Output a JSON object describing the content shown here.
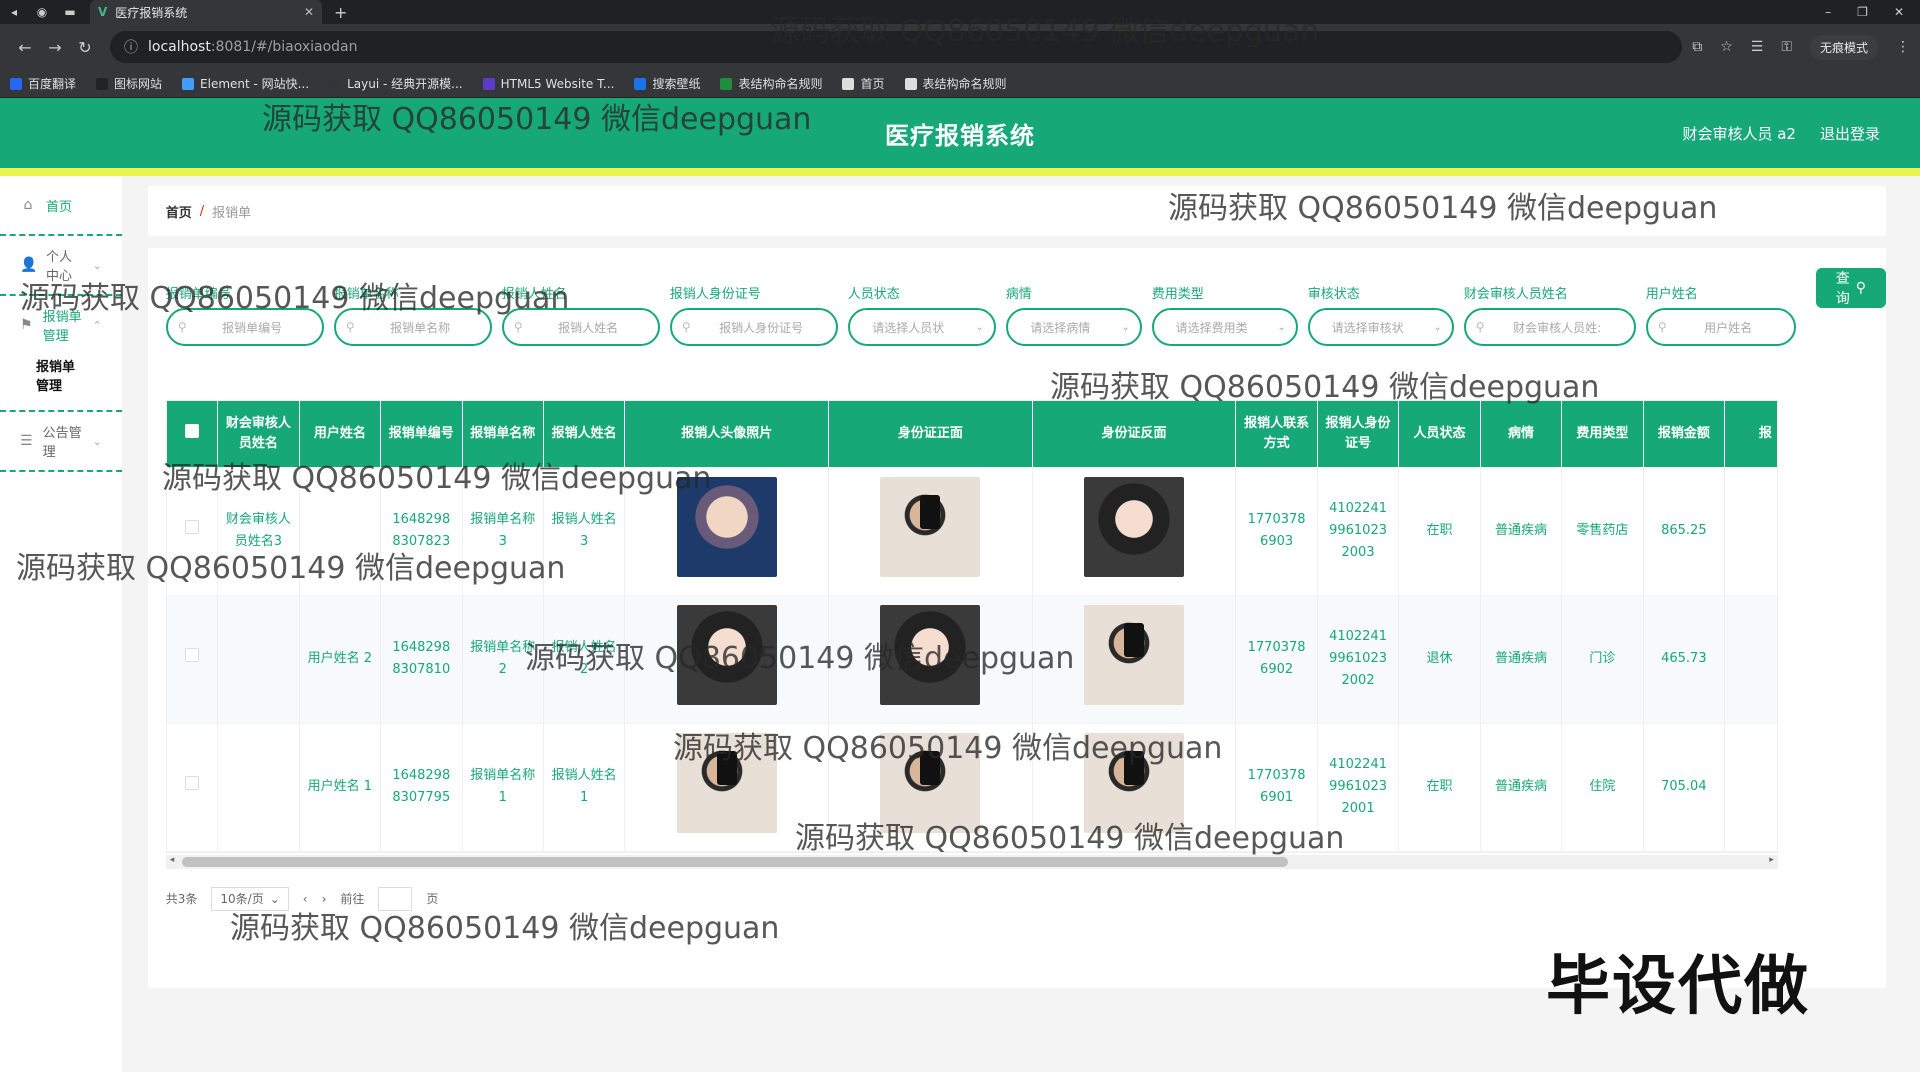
{
  "browser": {
    "tab_title": "医疗报销系统",
    "url_host": "localhost",
    "url_path": ":8081/#/biaoxiaodan",
    "incognito_label": "无痕模式",
    "bookmarks": [
      {
        "label": "百度翻译",
        "color": "#2468f2"
      },
      {
        "label": "图标网站",
        "color": "#222222"
      },
      {
        "label": "Element - 网站快...",
        "color": "#409eff"
      },
      {
        "label": "Layui - 经典开源模...",
        "color": "#2f363c"
      },
      {
        "label": "HTML5 Website T...",
        "color": "#5b3cc4"
      },
      {
        "label": "搜索壁纸",
        "color": "#1a73e8"
      },
      {
        "label": "表结构命名规则",
        "color": "#1e8e3e"
      },
      {
        "label": "首页",
        "color": "#dddddd"
      },
      {
        "label": "表结构命名规则",
        "color": "#dddddd"
      }
    ]
  },
  "header": {
    "title": "医疗报销系统",
    "user": "财会审核人员 a2",
    "logout": "退出登录"
  },
  "sidebar": {
    "home": "首页",
    "personal": "个人中心",
    "claims": "报销单管理",
    "claims_sub": "报销单管理",
    "notice": "公告管理"
  },
  "breadcrumb": {
    "home": "首页",
    "sep": "/",
    "current": "报销单"
  },
  "search": {
    "fields": [
      {
        "label": "报销单编号",
        "placeholder": "报销单编号",
        "type": "input",
        "width": 118
      },
      {
        "label": "报销单名称",
        "placeholder": "报销单名称",
        "type": "input",
        "width": 118
      },
      {
        "label": "报销人姓名",
        "placeholder": "报销人姓名",
        "type": "input",
        "width": 118
      },
      {
        "label": "报销人身份证号",
        "placeholder": "报销人身份证号",
        "type": "input",
        "width": 128
      },
      {
        "label": "人员状态",
        "placeholder": "请选择人员状",
        "type": "select",
        "width": 108
      },
      {
        "label": "病情",
        "placeholder": "请选择病情",
        "type": "select",
        "width": 96
      },
      {
        "label": "费用类型",
        "placeholder": "请选择费用类",
        "type": "select",
        "width": 106
      },
      {
        "label": "审核状态",
        "placeholder": "请选择审核状",
        "type": "select",
        "width": 106
      },
      {
        "label": "财会审核人员姓名",
        "placeholder": "财会审核人员姓:",
        "type": "input",
        "width": 132
      },
      {
        "label": "用户姓名",
        "placeholder": "用户姓名",
        "type": "input",
        "width": 110
      }
    ],
    "query_button": "查询"
  },
  "table": {
    "columns": [
      {
        "label": "",
        "w": 50
      },
      {
        "label": "财会审核人员姓名",
        "w": 80
      },
      {
        "label": "用户姓名",
        "w": 80
      },
      {
        "label": "报销单编号",
        "w": 80
      },
      {
        "label": "报销单名称",
        "w": 80
      },
      {
        "label": "报销人姓名",
        "w": 80
      },
      {
        "label": "报销人头像照片",
        "w": 200
      },
      {
        "label": "身份证正面",
        "w": 200
      },
      {
        "label": "身份证反面",
        "w": 200
      },
      {
        "label": "报销人联系方式",
        "w": 80
      },
      {
        "label": "报销人身份证号",
        "w": 80
      },
      {
        "label": "人员状态",
        "w": 80
      },
      {
        "label": "病情",
        "w": 80
      },
      {
        "label": "费用类型",
        "w": 80
      },
      {
        "label": "报销金额",
        "w": 80
      },
      {
        "label": "报",
        "w": 80
      }
    ],
    "rows": [
      {
        "auditor": "财会审核人员姓名3",
        "user": "",
        "code": "1648298 8307823",
        "name": "报销单名称3",
        "claimant": "报销人姓名3",
        "avatar": "boy",
        "idf": "man",
        "idb": "girl",
        "phone": "1770378 6903",
        "idno": "4102241 9961023 2003",
        "status": "在职",
        "illness": "普通疾病",
        "fee": "零售药店",
        "amount": "865.25"
      },
      {
        "auditor": "",
        "user": "用户姓名 2",
        "code": "1648298 8307810",
        "name": "报销单名称2",
        "claimant": "报销人姓名2",
        "avatar": "girl",
        "idf": "girl",
        "idb": "man",
        "phone": "1770378 6902",
        "idno": "4102241 9961023 2002",
        "status": "退休",
        "illness": "普通疾病",
        "fee": "门诊",
        "amount": "465.73"
      },
      {
        "auditor": "",
        "user": "用户姓名 1",
        "code": "1648298 8307795",
        "name": "报销单名称1",
        "claimant": "报销人姓名1",
        "avatar": "man",
        "idf": "man",
        "idb": "man",
        "phone": "1770378 6901",
        "idno": "4102241 9961023 2001",
        "status": "在职",
        "illness": "普通疾病",
        "fee": "住院",
        "amount": "705.04"
      }
    ]
  },
  "pager": {
    "total": "共3条",
    "size": "10条/页",
    "goto": "前往",
    "page_suffix": "页"
  },
  "watermarks": [
    {
      "text": "源码获取 QQ86050149 微信deepguan"
    }
  ],
  "badge": "毕设代做"
}
